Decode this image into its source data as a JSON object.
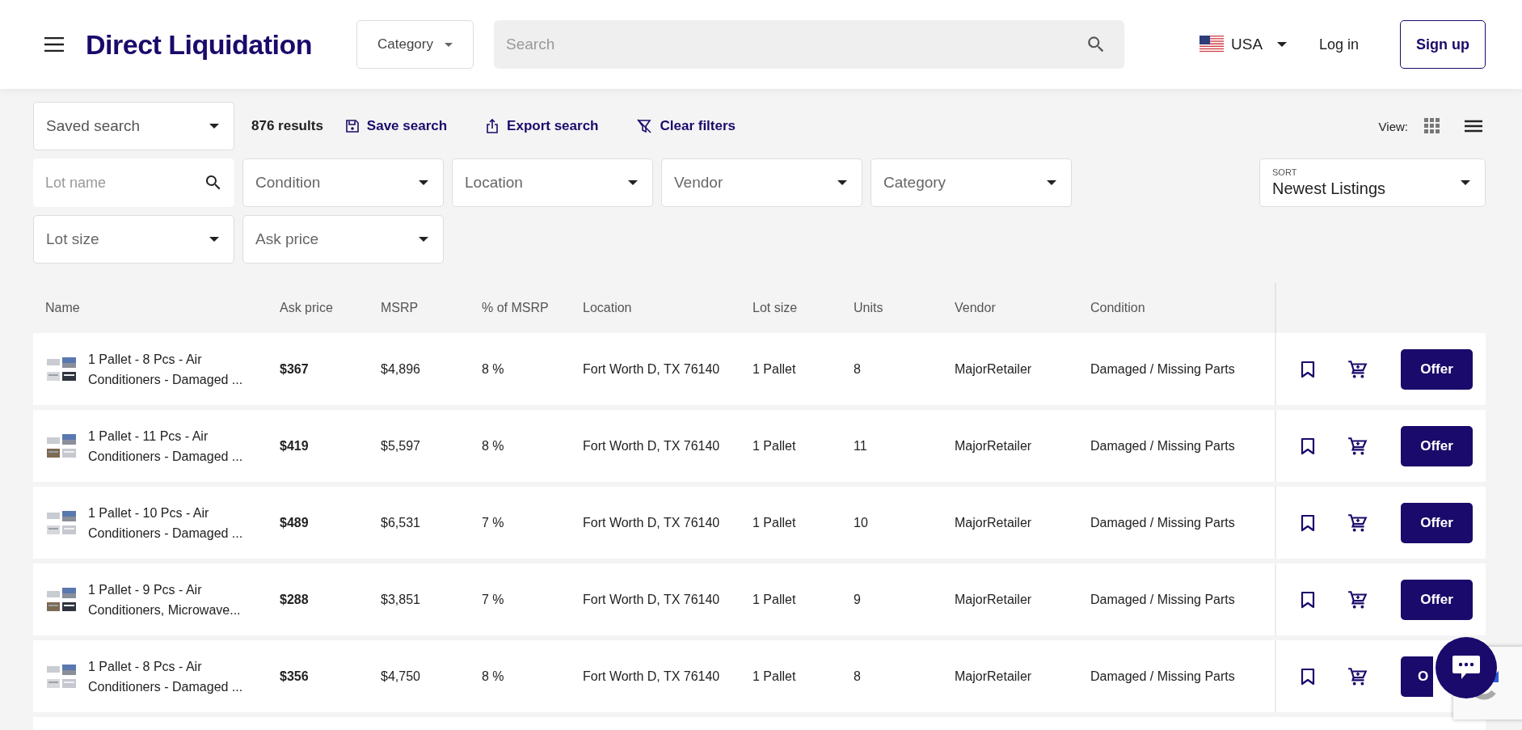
{
  "header": {
    "logo": "Direct Liquidation",
    "category_button": "Category",
    "search": {
      "placeholder": "Search"
    },
    "country": "USA",
    "login": "Log in",
    "signup": "Sign up"
  },
  "toolbar": {
    "saved_search": {
      "placeholder": "Saved search"
    },
    "results": "876 results",
    "actions": [
      {
        "kind": "save",
        "label": "Save search"
      },
      {
        "kind": "export",
        "label": "Export search"
      },
      {
        "kind": "clear",
        "label": "Clear filters"
      }
    ],
    "view": {
      "label": "View:",
      "options": [
        {
          "kind": "grid",
          "selected": false
        },
        {
          "kind": "list",
          "selected": true
        }
      ]
    }
  },
  "filters": [
    {
      "kind": "search",
      "placeholder": "Lot name"
    },
    {
      "kind": "select",
      "placeholder": "Condition"
    },
    {
      "kind": "select",
      "placeholder": "Location"
    },
    {
      "kind": "select",
      "placeholder": "Vendor"
    },
    {
      "kind": "select",
      "placeholder": "Category"
    },
    {
      "kind": "select",
      "placeholder": "Lot size"
    },
    {
      "kind": "select",
      "placeholder": "Ask price"
    }
  ],
  "sort": {
    "label": "SORT",
    "value": "Newest Listings"
  },
  "table": {
    "columns": [
      "Name",
      "Ask price",
      "MSRP",
      "% of MSRP",
      "Location",
      "Lot size",
      "Units",
      "Vendor",
      "Condition"
    ],
    "rows": [
      {
        "name": "1 Pallet - 8 Pcs - Air Conditioners - Damaged ...",
        "ask_price": "$367",
        "msrp": "$4,896",
        "pct": "8 %",
        "location": "Fort Worth D, TX 76140",
        "lot_size": "1 Pallet",
        "units": "8",
        "vendor": "MajorRetailer",
        "condition": "Damaged / Missing Parts",
        "offer": "Offer"
      },
      {
        "name": "1 Pallet - 11 Pcs - Air Conditioners - Damaged ...",
        "ask_price": "$419",
        "msrp": "$5,597",
        "pct": "8 %",
        "location": "Fort Worth D, TX 76140",
        "lot_size": "1 Pallet",
        "units": "11",
        "vendor": "MajorRetailer",
        "condition": "Damaged / Missing Parts",
        "offer": "Offer"
      },
      {
        "name": "1 Pallet - 10 Pcs - Air Conditioners - Damaged ...",
        "ask_price": "$489",
        "msrp": "$6,531",
        "pct": "7 %",
        "location": "Fort Worth D, TX 76140",
        "lot_size": "1 Pallet",
        "units": "10",
        "vendor": "MajorRetailer",
        "condition": "Damaged / Missing Parts",
        "offer": "Offer"
      },
      {
        "name": "1 Pallet - 9 Pcs - Air Conditioners, Microwave...",
        "ask_price": "$288",
        "msrp": "$3,851",
        "pct": "7 %",
        "location": "Fort Worth D, TX 76140",
        "lot_size": "1 Pallet",
        "units": "9",
        "vendor": "MajorRetailer",
        "condition": "Damaged / Missing Parts",
        "offer": "Offer"
      },
      {
        "name": "1 Pallet - 8 Pcs - Air Conditioners - Damaged ...",
        "ask_price": "$356",
        "msrp": "$4,750",
        "pct": "8 %",
        "location": "Fort Worth D, TX 76140",
        "lot_size": "1 Pallet",
        "units": "8",
        "vendor": "MajorRetailer",
        "condition": "Damaged / Missing Parts",
        "offer": "O"
      }
    ]
  }
}
